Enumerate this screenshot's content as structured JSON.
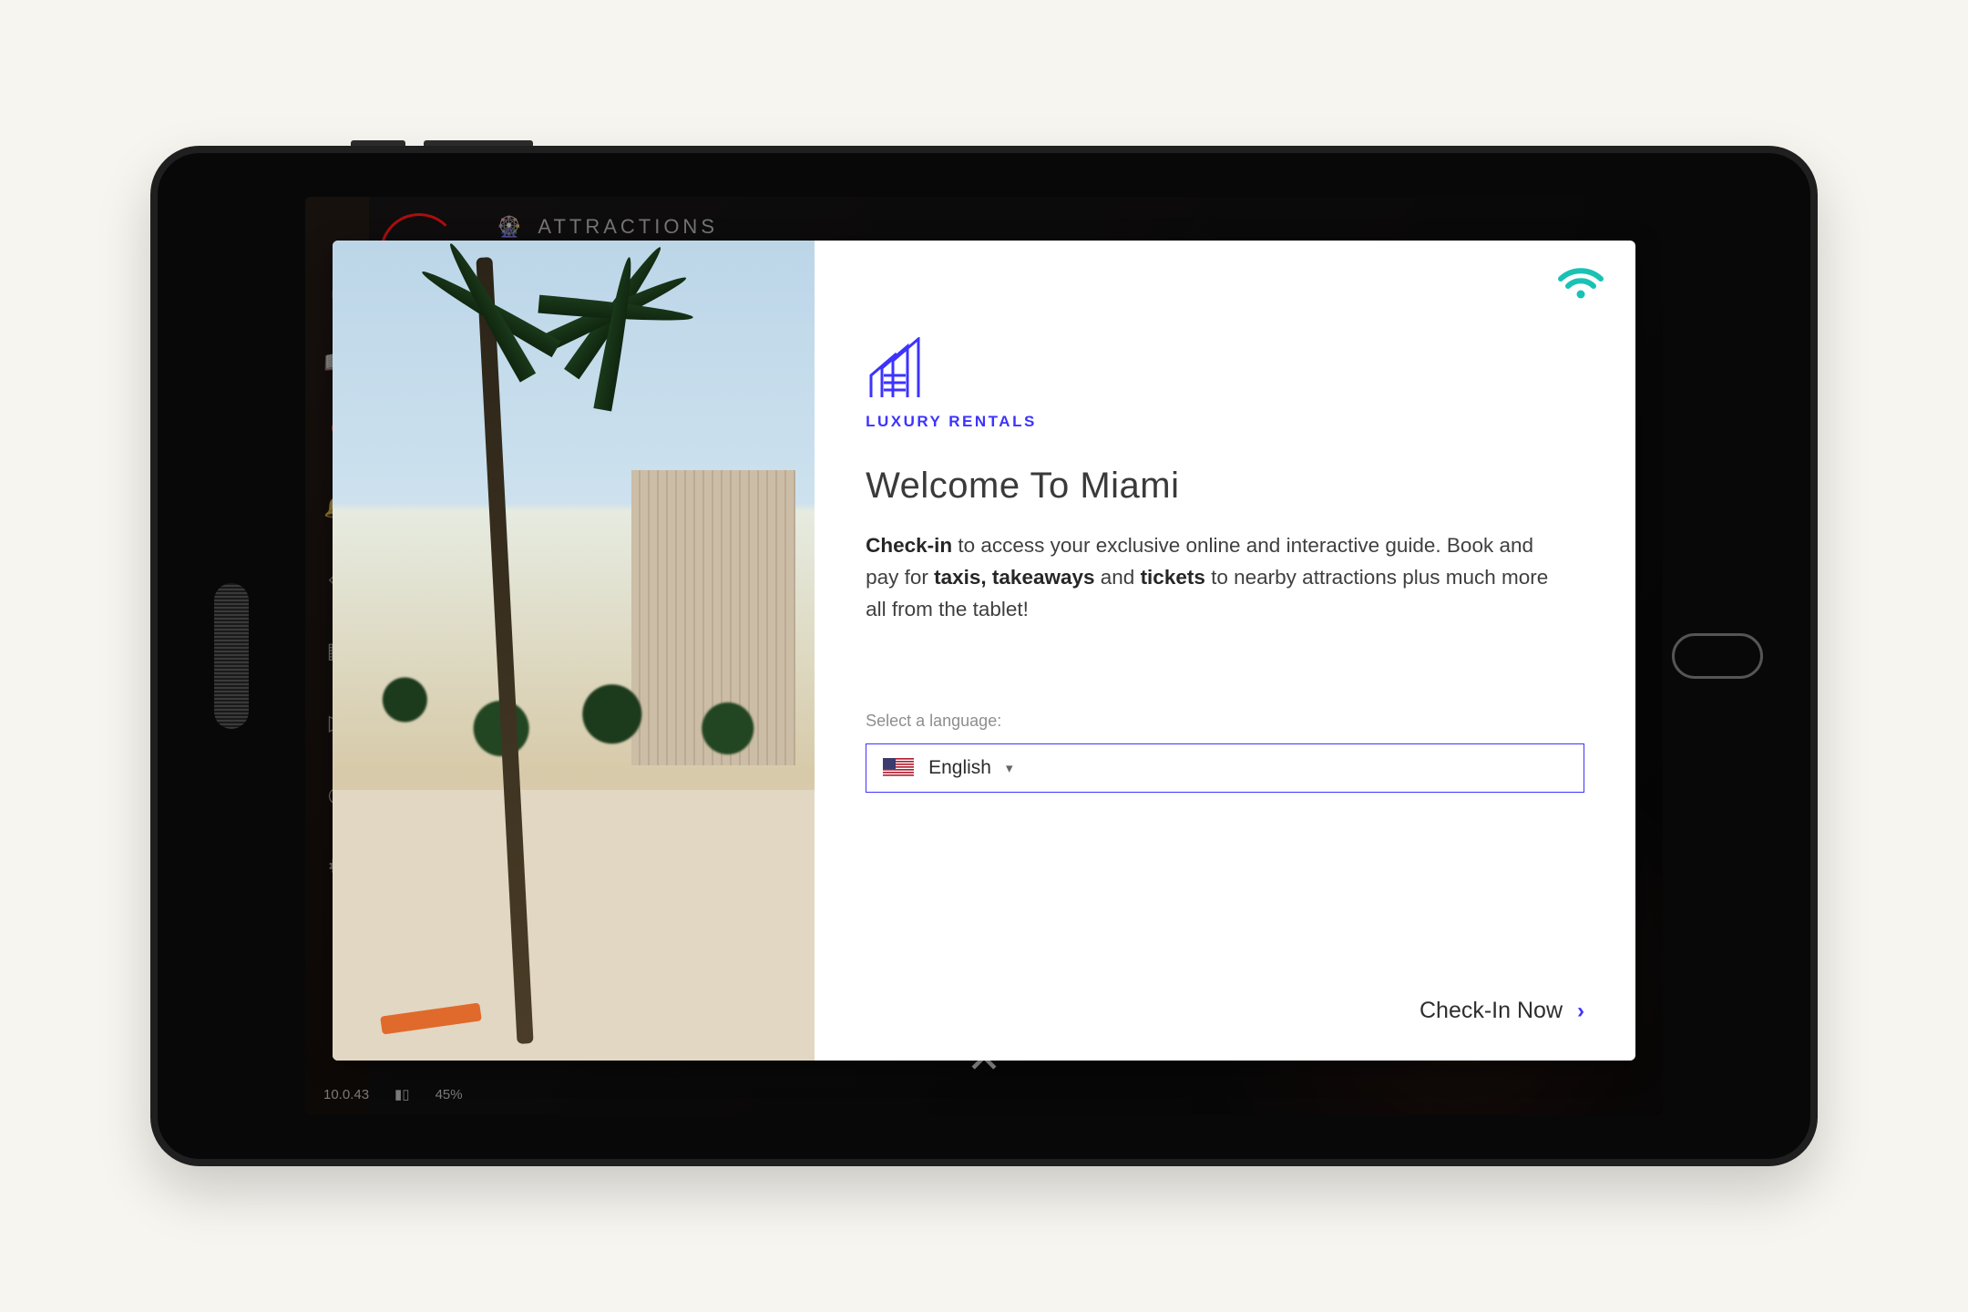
{
  "background": {
    "header_label": "ATTRACTIONS",
    "status": {
      "time": "10.0.43",
      "battery_pct": "45%"
    }
  },
  "modal": {
    "brand_name": "LUXURY RENTALS",
    "title": "Welcome To Miami",
    "body": {
      "b1": "Check-in",
      "t1": " to access your exclusive online and interactive guide. Book and pay for ",
      "b2": "taxis, takeaways",
      "t2": " and ",
      "b3": "tickets",
      "t3": " to nearby attractions plus much more all from the tablet!"
    },
    "language": {
      "label": "Select a language:",
      "selected": "English"
    },
    "checkin_label": "Check-In Now",
    "colors": {
      "accent": "#3d33ff",
      "wifi": "#18c2b4"
    }
  }
}
